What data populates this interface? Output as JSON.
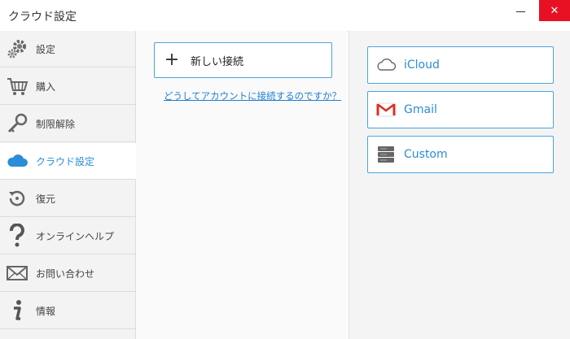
{
  "window": {
    "title": "クラウド設定",
    "close_symbol": "✕"
  },
  "sidebar": {
    "items": [
      {
        "label": "設定",
        "icon": "gears-icon"
      },
      {
        "label": "購入",
        "icon": "cart-icon"
      },
      {
        "label": "制限解除",
        "icon": "key-icon"
      },
      {
        "label": "クラウド設定",
        "icon": "cloud-icon",
        "active": true
      },
      {
        "label": "復元",
        "icon": "restore-icon"
      },
      {
        "label": "オンラインヘルプ",
        "icon": "question-icon"
      },
      {
        "label": "お問い合わせ",
        "icon": "mail-icon"
      },
      {
        "label": "情報",
        "icon": "info-icon"
      }
    ]
  },
  "middle": {
    "new_connection_label": "新しい接続",
    "plus_symbol": "+",
    "help_link": "どうしてアカウントに接続するのですか？"
  },
  "providers": [
    {
      "label": "iCloud",
      "icon": "icloud-icon"
    },
    {
      "label": "Gmail",
      "icon": "gmail-icon"
    },
    {
      "label": "Custom",
      "icon": "server-icon"
    }
  ],
  "colors": {
    "accent": "#2a8dd6",
    "border_accent": "#4aa3df",
    "close_button": "#e81123",
    "gmail_red": "#d93025"
  }
}
